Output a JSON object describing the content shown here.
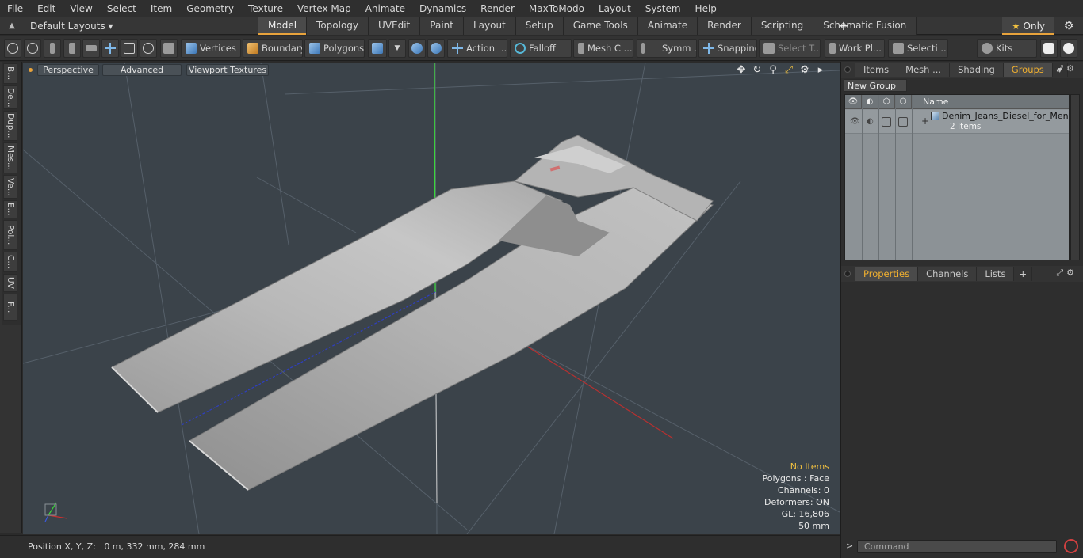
{
  "menu": [
    "File",
    "Edit",
    "View",
    "Select",
    "Item",
    "Geometry",
    "Texture",
    "Vertex Map",
    "Animate",
    "Dynamics",
    "Render",
    "MaxToModo",
    "Layout",
    "System",
    "Help"
  ],
  "layouts_label": "Default Layouts",
  "layout_tabs": [
    {
      "label": "Model",
      "active": true
    },
    {
      "label": "Topology"
    },
    {
      "label": "UVEdit"
    },
    {
      "label": "Paint"
    },
    {
      "label": "Layout"
    },
    {
      "label": "Setup"
    },
    {
      "label": "Game Tools"
    },
    {
      "label": "Animate"
    },
    {
      "label": "Render"
    },
    {
      "label": "Scripting"
    },
    {
      "label": "Schematic Fusion"
    }
  ],
  "only_label": "Only",
  "toolbar": {
    "vertices": "Vertices",
    "boundary": "Boundary",
    "polygons": "Polygons",
    "action": "Action",
    "falloff": "Falloff",
    "mesh_c": "Mesh C ...",
    "symm": "Symm ...",
    "snapping": "Snapping",
    "select_t": "Select T...",
    "work_pl": "Work Pl...",
    "selecti": "Selecti ...",
    "kits": "Kits"
  },
  "left_tabs": [
    "B...",
    "De...",
    "Dup...",
    "Mes...",
    "Ve...",
    "E...",
    "Pol...",
    "C...",
    "UV",
    "F..."
  ],
  "viewport": {
    "perspective": "Perspective",
    "advanced": "Advanced",
    "viewport_textures": "Viewport Textures",
    "stats": {
      "no_items": "No Items",
      "polygons": "Polygons : Face",
      "channels": "Channels: 0",
      "deformers": "Deformers: ON",
      "gl": "GL: 16,806",
      "scale": "50 mm"
    }
  },
  "status": {
    "label": "Position X, Y, Z:",
    "value": "0 m, 332 mm, 284 mm"
  },
  "right_top_tabs": [
    {
      "label": "Items"
    },
    {
      "label": "Mesh ..."
    },
    {
      "label": "Shading"
    },
    {
      "label": "Groups",
      "active": true
    }
  ],
  "groups": {
    "new_group": "New Group",
    "col_name": "Name",
    "item_name": "Denim_Jeans_Diesel_for_Men...",
    "item_sub": "2 Items"
  },
  "right_bottom_tabs": [
    {
      "label": "Properties",
      "active": true
    },
    {
      "label": "Channels"
    },
    {
      "label": "Lists"
    }
  ],
  "command_placeholder": "Command",
  "colors": {
    "accent": "#e8a33c",
    "viewport_bg": "#3b434a",
    "axis_y": "#39d839",
    "axis_x": "#c83030",
    "axis_z": "#3040c8"
  }
}
